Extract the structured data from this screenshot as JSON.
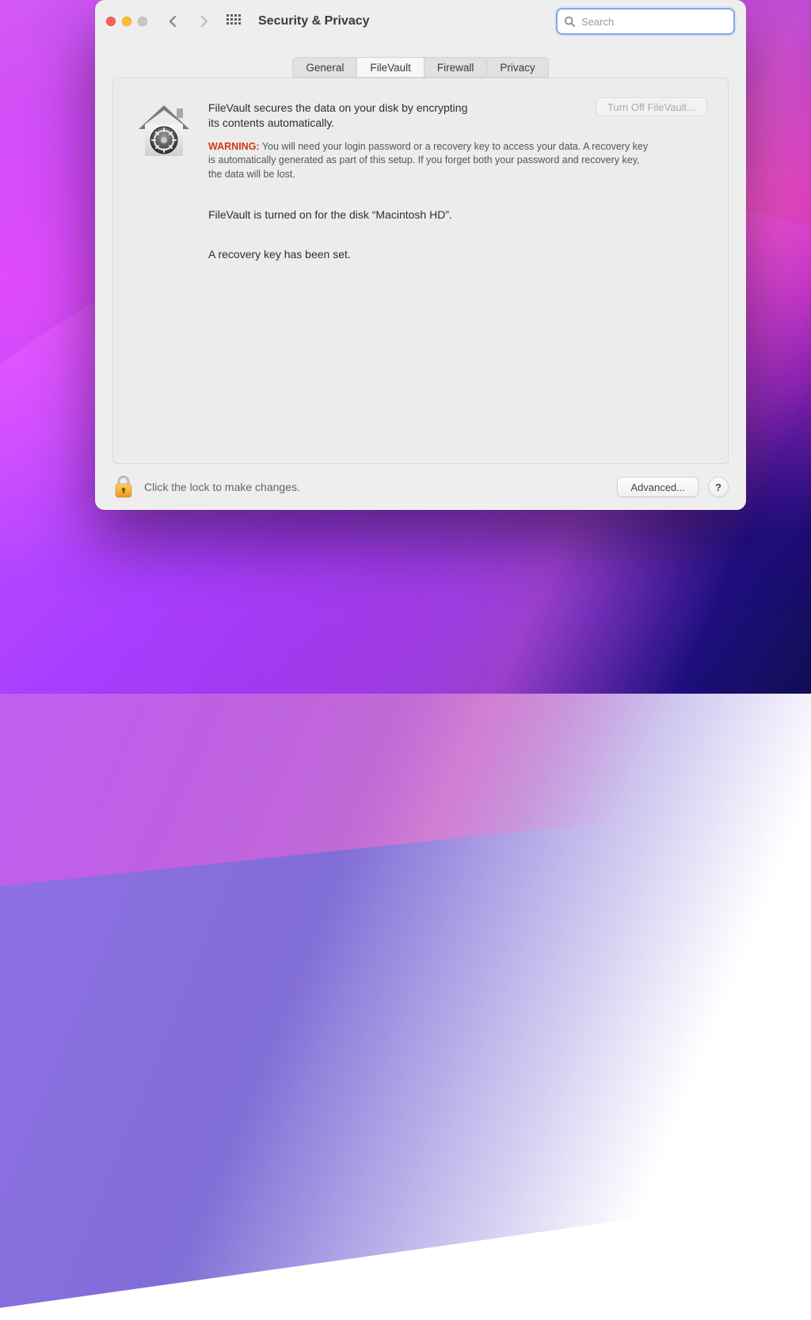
{
  "colors": {
    "search_focus_ring": "#7fa9e6",
    "warning_label": "#d13a0e"
  },
  "titlebar": {
    "title": "Security & Privacy"
  },
  "search": {
    "placeholder": "Search",
    "value": ""
  },
  "tabs": {
    "items": [
      {
        "id": "general",
        "label": "General"
      },
      {
        "id": "filevault",
        "label": "FileVault"
      },
      {
        "id": "firewall",
        "label": "Firewall"
      },
      {
        "id": "privacy",
        "label": "Privacy"
      }
    ],
    "active": "filevault"
  },
  "filevault": {
    "description": "FileVault secures the data on your disk by encrypting its contents automatically.",
    "warning_label": "WARNING:",
    "warning_text": "You will need your login password or a recovery key to access your data. A recovery key is automatically generated as part of this setup. If you forget both your password and recovery key, the data will be lost.",
    "status_line": "FileVault is turned on for the disk “Macintosh HD”.",
    "recovery_line": "A recovery key has been set.",
    "turn_off_label": "Turn Off FileVault..."
  },
  "footer": {
    "lock_hint": "Click the lock to make changes.",
    "advanced_label": "Advanced...",
    "help_label": "?"
  }
}
